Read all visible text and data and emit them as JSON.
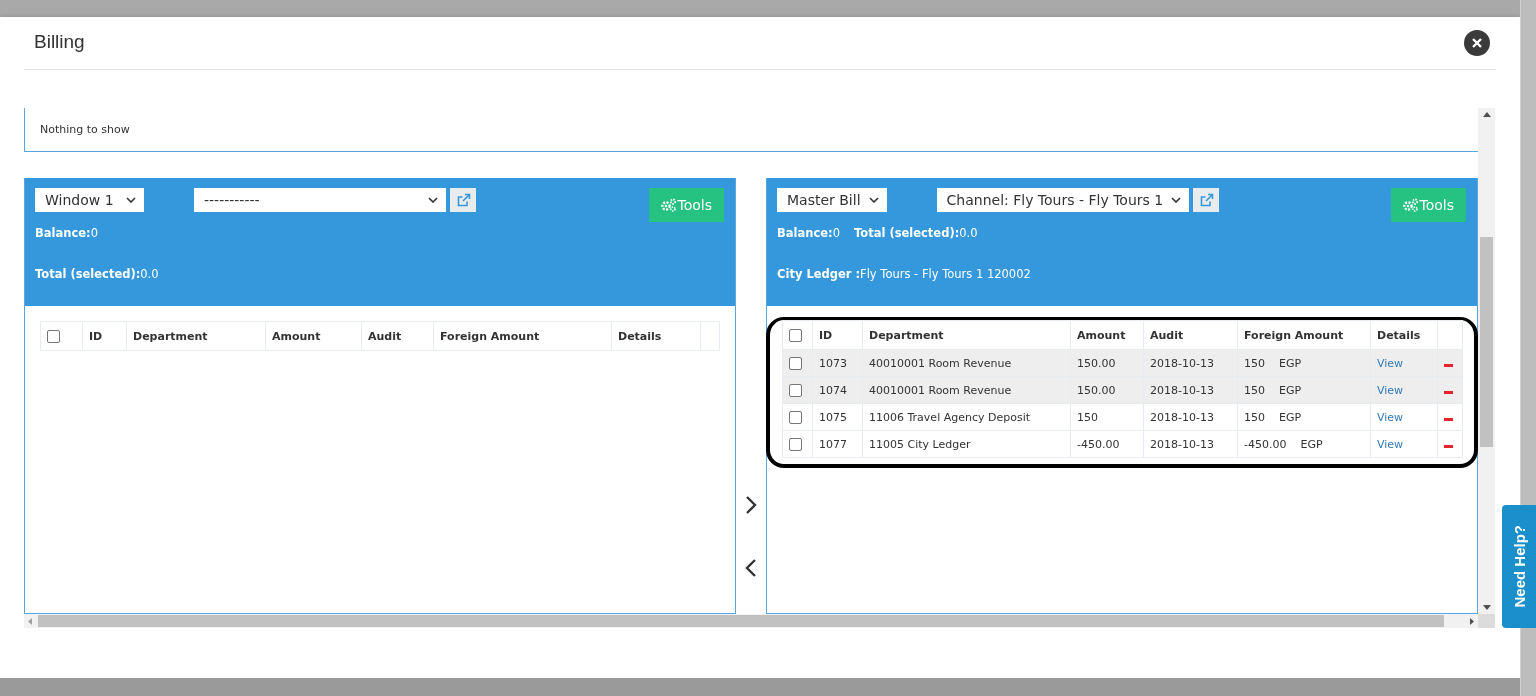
{
  "window": {
    "title": "Billing"
  },
  "notice": "Nothing to show",
  "panels": [
    {
      "window_select": "Window 1",
      "bill_select": "-----------",
      "tools": "Tools",
      "info_lines": [
        [
          {
            "label": "Balance:",
            "value": "0"
          }
        ],
        [
          {
            "label": "Total (selected):",
            "value": "0.0"
          }
        ]
      ],
      "header_checked": false,
      "columns": [
        "ID",
        "Department",
        "Amount",
        "Audit",
        "Foreign Amount",
        "Details"
      ]
    },
    {
      "window_select": "Master Bill",
      "bill_select": "Channel: Fly Tours - Fly Tours 1",
      "tools": "Tools",
      "info_lines": [
        [
          {
            "label": "Balance:",
            "value": "0"
          },
          {
            "label": "Total (selected):",
            "value": "0.0"
          }
        ],
        [
          {
            "label": "City Ledger :",
            "value": "Fly Tours - Fly Tours 1 120002"
          }
        ]
      ],
      "header_checked": false,
      "columns": [
        "ID",
        "Department",
        "Amount",
        "Audit",
        "Foreign Amount",
        "Details"
      ],
      "rows": [
        {
          "checked": false,
          "shaded": true,
          "id": "1073",
          "department": "40010001 Room Revenue",
          "amount": "150.00",
          "audit": "2018-10-13",
          "foreign_amount": "150",
          "currency": "EGP",
          "details": "View"
        },
        {
          "checked": false,
          "shaded": true,
          "id": "1074",
          "department": "40010001 Room Revenue",
          "amount": "150.00",
          "audit": "2018-10-13",
          "foreign_amount": "150",
          "currency": "EGP",
          "details": "View"
        },
        {
          "checked": false,
          "shaded": false,
          "id": "1075",
          "department": "11006 Travel Agency Deposit",
          "amount": "150",
          "audit": "2018-10-13",
          "foreign_amount": "150",
          "currency": "EGP",
          "details": "View"
        },
        {
          "checked": false,
          "shaded": false,
          "id": "1077",
          "department": "11005 City Ledger",
          "amount": "-450.00",
          "audit": "2018-10-13",
          "foreign_amount": "-450.00",
          "currency": "EGP",
          "details": "View"
        }
      ]
    }
  ],
  "help_tab": "Need Help?"
}
